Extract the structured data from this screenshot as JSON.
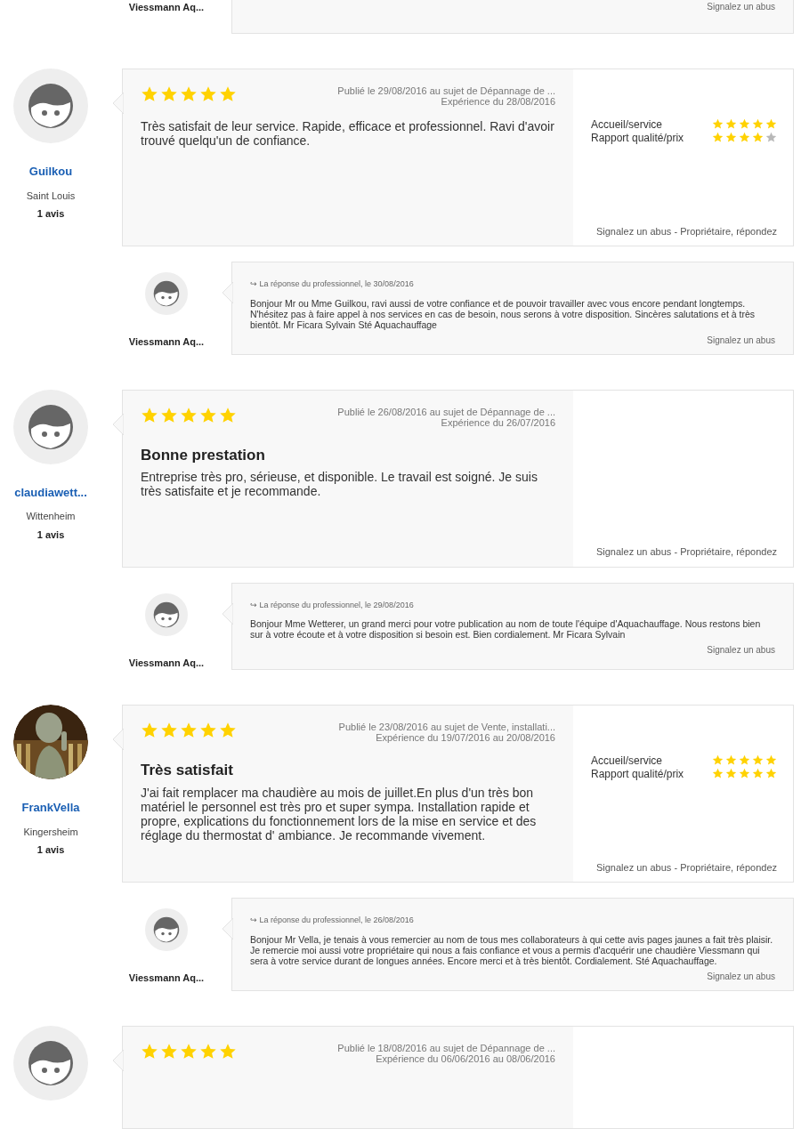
{
  "items": [
    {
      "kind": "reply_tail",
      "author": "Viessmann Aq...",
      "report": "Signalez un abus"
    },
    {
      "kind": "review",
      "avatar": {
        "kind": "default"
      },
      "author": "Guilkou",
      "city": "Saint Louis",
      "count": "1 avis",
      "stars": 5,
      "published": "Publié le 29/08/2016 au sujet de Dépannage de ...",
      "experience": "Expérience du 28/08/2016",
      "text": "Très satisfait de leur service. Rapide, efficace et professionnel. Ravi d'avoir trouvé quelqu'un de confiance.",
      "criteria": [
        {
          "label": "Accueil/service",
          "stars": 5
        },
        {
          "label": "Rapport qualité/prix",
          "stars": 4
        }
      ],
      "report": "Signalez un abus",
      "separator": "-",
      "owner_link": "Propriétaire, répondez"
    },
    {
      "kind": "reply",
      "author": "Viessmann Aq...",
      "arrow": "↪",
      "date_line": "La réponse du professionnel, le 30/08/2016",
      "text": "Bonjour Mr ou Mme Guilkou, ravi aussi de votre confiance et de pouvoir travailler avec vous encore pendant longtemps. N'hésitez pas à faire appel à nos services en cas de besoin, nous serons à votre disposition. Sincères salutations et à très bientôt. Mr Ficara Sylvain Sté Aquachauffage",
      "report": "Signalez un abus"
    },
    {
      "kind": "review",
      "avatar": {
        "kind": "default"
      },
      "author": "claudiawett...",
      "city": "Wittenheim",
      "count": "1 avis",
      "stars": 5,
      "published": "Publié le 26/08/2016 au sujet de Dépannage de ...",
      "experience": "Expérience du 26/07/2016",
      "title": "Bonne prestation",
      "text": "Entreprise très pro, sérieuse, et disponible. Le travail est soigné. Je suis très satisfaite et je recommande.",
      "report": "Signalez un abus",
      "separator": "-",
      "owner_link": "Propriétaire, répondez"
    },
    {
      "kind": "reply",
      "author": "Viessmann Aq...",
      "arrow": "↪",
      "date_line": "La réponse du professionnel, le 29/08/2016",
      "text": "Bonjour Mme Wetterer, un grand merci pour votre publication au nom de toute l'équipe d'Aquachauffage. Nous restons bien sur à votre écoute et à votre disposition si besoin est. Bien cordialement. Mr Ficara Sylvain",
      "report": "Signalez un abus"
    },
    {
      "kind": "review",
      "author": "FrankVella",
      "city": "Kingersheim",
      "count": "1 avis",
      "stars": 5,
      "published": "Publié le 23/08/2016 au sujet de Vente, installati...",
      "experience": "Expérience du 19/07/2016 au 20/08/2016",
      "title": "Très satisfait",
      "text": "J'ai fait remplacer ma chaudière au mois de juillet.En plus d'un très bon matériel le personnel est très pro et super sympa. Installation rapide et propre, explications du fonctionnement lors de la mise en service et des réglage du thermostat d' ambiance. Je recommande vivement.",
      "criteria": [
        {
          "label": "Accueil/service",
          "stars": 5
        },
        {
          "label": "Rapport qualité/prix",
          "stars": 5
        }
      ],
      "report": "Signalez un abus",
      "separator": "-",
      "owner_link": "Propriétaire, répondez"
    },
    {
      "kind": "reply",
      "author": "Viessmann Aq...",
      "arrow": "↪",
      "date_line": "La réponse du professionnel, le 26/08/2016",
      "text": "Bonjour Mr Vella, je tenais à vous remercier au nom de tous mes collaborateurs à qui cette avis pages jaunes a fait très plaisir. Je remercie moi aussi votre propriétaire qui nous a fais confiance et vous a permis d'acquérir une chaudière Viessmann qui sera à votre service durant de longues années. Encore merci et à très bientôt. Cordialement. Sté Aquachauffage.",
      "report": "Signalez un abus"
    },
    {
      "kind": "review",
      "avatar": {
        "kind": "default"
      },
      "stars": 5,
      "published": "Publié le 18/08/2016 au sujet de Dépannage de ...",
      "experience": "Expérience du 06/06/2016 au 08/06/2016"
    }
  ]
}
